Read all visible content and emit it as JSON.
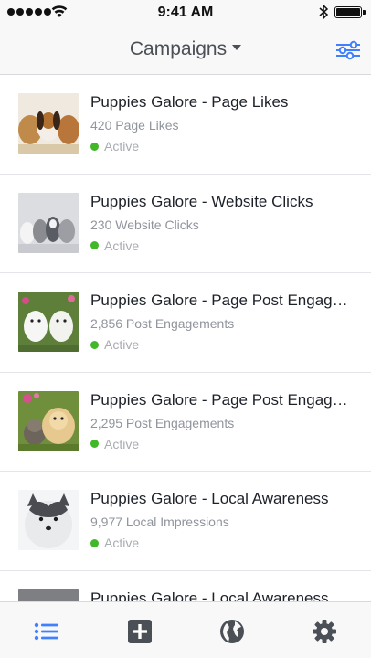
{
  "status_bar": {
    "time": "9:41 AM",
    "signal_icon": "signal-dots-icon",
    "wifi_icon": "wifi-icon",
    "bluetooth_icon": "bluetooth-icon",
    "battery_icon": "battery-icon",
    "battery_level": 1.0
  },
  "nav": {
    "title": "Campaigns",
    "title_icon": "chevron-down-icon",
    "filter_icon": "filter-sliders-icon"
  },
  "colors": {
    "accent": "#4080ff",
    "active_green": "#42b72a",
    "tab_inactive": "#4b4f56"
  },
  "campaigns": [
    {
      "name": "Puppies Galore - Page Likes",
      "metric": "420 Page Likes",
      "status": "Active",
      "thumb": "puppies-three-photo"
    },
    {
      "name": "Puppies Galore - Website Clicks",
      "metric": "230 Website Clicks",
      "status": "Active",
      "thumb": "husky-puppies-photo"
    },
    {
      "name": "Puppies Galore - Page Post Engagement",
      "metric": "2,856 Post Engagements",
      "status": "Active",
      "thumb": "white-puppies-photo"
    },
    {
      "name": "Puppies Galore - Page Post Engagement",
      "metric": "2,295 Post Engagements",
      "status": "Active",
      "thumb": "puppy-kitten-photo"
    },
    {
      "name": "Puppies Galore - Local Awareness",
      "metric": "9,977 Local Impressions",
      "status": "Active",
      "thumb": "husky-puppy-photo"
    },
    {
      "name": "Puppies Galore - Local Awareness",
      "metric": "",
      "status": "",
      "thumb": "puppy-photo"
    }
  ],
  "tabs": [
    {
      "name": "campaigns-list-tab",
      "icon": "list-icon",
      "active": true
    },
    {
      "name": "create-tab",
      "icon": "plus-square-icon",
      "active": false
    },
    {
      "name": "globe-tab",
      "icon": "globe-icon",
      "active": false
    },
    {
      "name": "settings-tab",
      "icon": "gear-icon",
      "active": false
    }
  ]
}
